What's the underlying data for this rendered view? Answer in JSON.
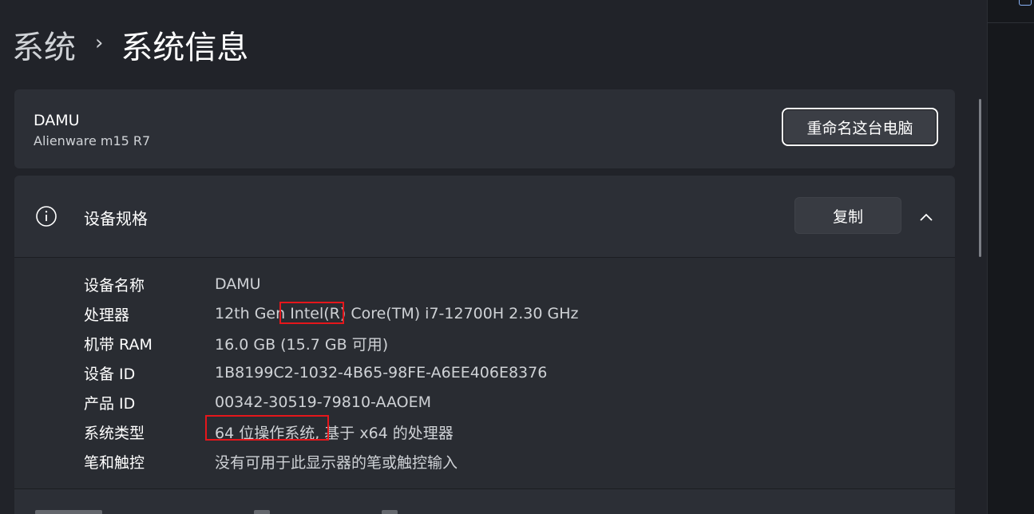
{
  "breadcrumb": {
    "parent": "系统",
    "separator": "›",
    "current": "系统信息"
  },
  "device": {
    "name": "DAMU",
    "model": "Alienware m15 R7",
    "rename_label": "重命名这台电脑"
  },
  "specs": {
    "title": "设备规格",
    "copy_label": "复制",
    "rows": [
      {
        "label": "设备名称",
        "value": "DAMU"
      },
      {
        "label": "处理器",
        "value": "12th Gen Intel(R) Core(TM) i7-12700H   2.30 GHz"
      },
      {
        "label": "机带 RAM",
        "value": "16.0 GB (15.7 GB 可用)"
      },
      {
        "label": "设备 ID",
        "value": "1B8199C2-1032-4B65-98FE-A6EE406E8376"
      },
      {
        "label": "产品 ID",
        "value": "00342-30519-79810-AAOEM"
      },
      {
        "label": "系统类型",
        "value": "64 位操作系统, 基于 x64 的处理器"
      },
      {
        "label": "笔和触控",
        "value": "没有可用于此显示器的笔或触控输入"
      }
    ]
  },
  "icons": {
    "info": "info-icon",
    "chevron": "chevron-up-icon"
  },
  "colors": {
    "background": "#212329",
    "card": "#2c2f36",
    "highlight": "#e5161b"
  }
}
